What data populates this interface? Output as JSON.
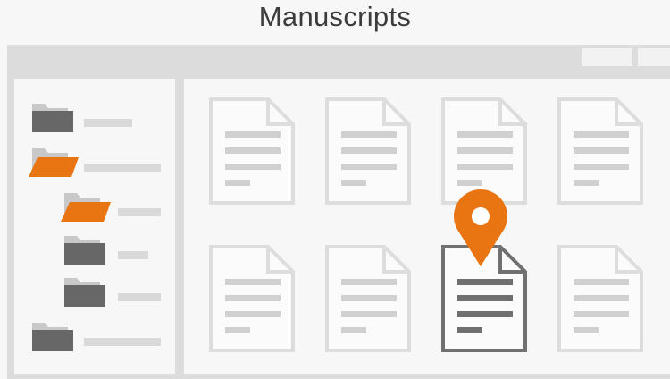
{
  "page": {
    "title": "Manuscripts"
  },
  "colors": {
    "background": "#f7f7f8",
    "window_frame": "#dcdcdc",
    "pane_background": "#f7f7f8",
    "folder_dark": "#676767",
    "folder_tab_light": "#c8c8c8",
    "folder_accent": "#e87511",
    "file_outline": "#dddddd",
    "file_lines": "#d0d0d0",
    "selected_file_outline": "#707070",
    "selected_file_lines": "#707070",
    "label_bar": "#d9d9d9",
    "pin": "#e87511"
  },
  "window": {
    "titlebar_buttons": [
      "window-control-1",
      "window-control-2"
    ]
  },
  "folder_tree": [
    {
      "level": 0,
      "state": "closed"
    },
    {
      "level": 0,
      "state": "open-highlighted"
    },
    {
      "level": 1,
      "state": "open-highlighted"
    },
    {
      "level": 1,
      "state": "closed"
    },
    {
      "level": 1,
      "state": "closed"
    },
    {
      "level": 0,
      "state": "closed"
    }
  ],
  "files": [
    {
      "row": 0,
      "col": 0,
      "selected": false
    },
    {
      "row": 0,
      "col": 1,
      "selected": false
    },
    {
      "row": 0,
      "col": 2,
      "selected": false
    },
    {
      "row": 0,
      "col": 3,
      "selected": false
    },
    {
      "row": 1,
      "col": 0,
      "selected": false
    },
    {
      "row": 1,
      "col": 1,
      "selected": false
    },
    {
      "row": 1,
      "col": 2,
      "selected": true,
      "pinned": true
    },
    {
      "row": 1,
      "col": 3,
      "selected": false
    }
  ],
  "icons": {
    "folder": "folder-icon",
    "file": "file-icon",
    "pin": "location-pin-icon"
  }
}
